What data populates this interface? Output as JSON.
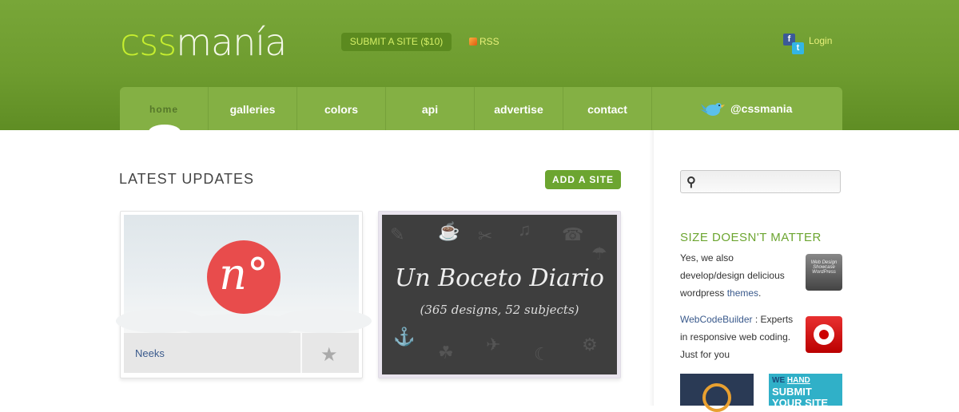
{
  "header": {
    "logo_part1": "css",
    "logo_part2": "manía",
    "submit_label": "SUBMIT A SITE ($10)",
    "rss_label": "RSS",
    "login_label": "Login",
    "social_icons": [
      "facebook-icon",
      "twitter-icon"
    ]
  },
  "nav": {
    "items": [
      {
        "label": "home"
      },
      {
        "label": "galleries"
      },
      {
        "label": "colors"
      },
      {
        "label": "api"
      },
      {
        "label": "advertise"
      },
      {
        "label": "contact"
      }
    ],
    "twitter_handle": "@cssmania"
  },
  "main": {
    "title": "LATEST UPDATES",
    "add_site_label": "ADD A SITE",
    "cards": [
      {
        "name": "Neeks",
        "logo_text": "n°"
      },
      {
        "title": "Un Boceto Diario",
        "subtitle": "(365 designs, 52 subjects)"
      }
    ]
  },
  "sidebar": {
    "search_placeholder": "",
    "heading": "SIZE DOESN'T MATTER",
    "promo1": {
      "text_pre": "Yes, we also develop/design delicious wordpress ",
      "link": "themes",
      "text_post": ".",
      "badge_text": "Web Design Showcase WordPress"
    },
    "promo2": {
      "link": "WebCodeBuilder",
      "text_post": " : Experts in responsive web coding. Just for you"
    },
    "ad2": {
      "we": "WE",
      "hand": "HAND",
      "line1": "SUBMIT",
      "line2": "YOUR SITE"
    }
  },
  "colors": {
    "header_green": "#6e9c2f",
    "accent_green": "#6ca530",
    "link_blue": "#3a5a8c"
  }
}
